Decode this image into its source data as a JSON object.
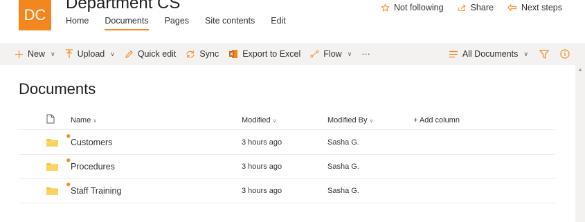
{
  "site": {
    "logo_text": "DC",
    "title": "Department CS",
    "nav": [
      "Home",
      "Documents",
      "Pages",
      "Site contents",
      "Edit"
    ],
    "actions": {
      "follow": "Not following",
      "share": "Share",
      "next_steps": "Next steps"
    }
  },
  "toolbar": {
    "new": "New",
    "upload": "Upload",
    "quick_edit": "Quick edit",
    "sync": "Sync",
    "export": "Export to Excel",
    "flow": "Flow",
    "more": "···",
    "view": "All Documents"
  },
  "library": {
    "title": "Documents",
    "columns": {
      "name": "Name",
      "modified": "Modified",
      "modified_by": "Modified By",
      "add": "+ Add column"
    },
    "rows": [
      {
        "name": "Customers",
        "modified": "3 hours ago",
        "modified_by": "Sasha G."
      },
      {
        "name": "Procedures",
        "modified": "3 hours ago",
        "modified_by": "Sasha G."
      },
      {
        "name": "Staff Training",
        "modified": "3 hours ago",
        "modified_by": "Sasha G."
      }
    ]
  },
  "colors": {
    "accent": "#f2871f",
    "command_bar": "#f3f2f1",
    "folder": "#f8c53c"
  }
}
